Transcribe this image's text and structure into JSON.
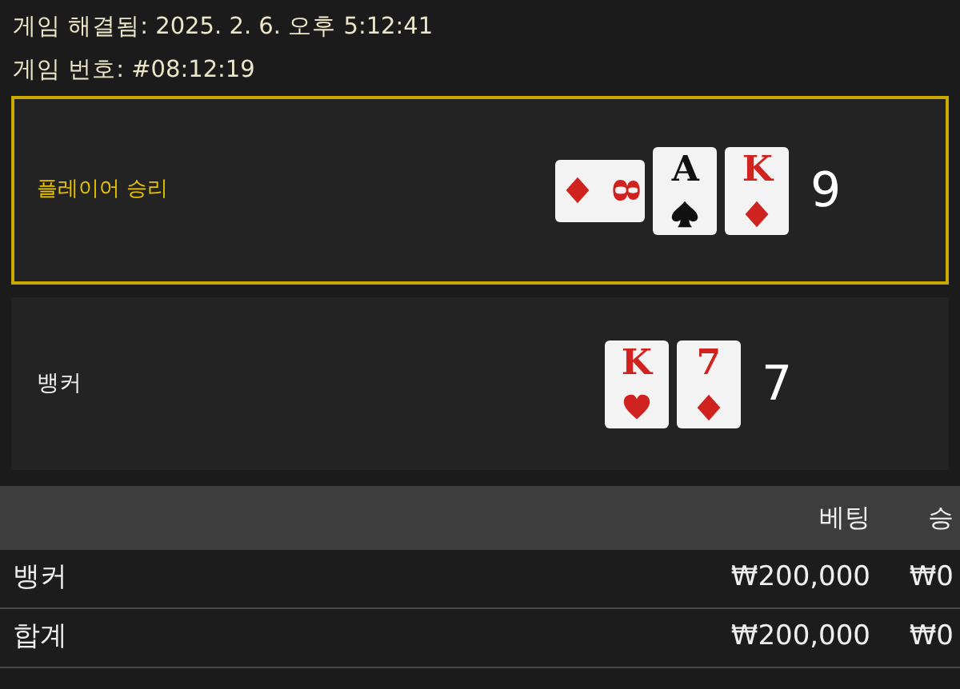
{
  "info": [
    {
      "label": "게임 해결됨:",
      "value": "2025. 2. 6. 오후 5:12:41"
    },
    {
      "label": "게임 번호:",
      "value": "#08:12:19"
    }
  ],
  "hands": [
    {
      "label": "플레이어 승리",
      "winner": true,
      "score": "9",
      "cards": [
        {
          "rank": "8",
          "kind": "diamond",
          "sideways": true
        },
        {
          "rank": "A",
          "kind": "spade",
          "sideways": false
        },
        {
          "rank": "K",
          "kind": "diamond",
          "sideways": false
        }
      ]
    },
    {
      "label": "뱅커",
      "winner": false,
      "score": "7",
      "cards": [
        {
          "rank": "K",
          "kind": "heart",
          "sideways": false
        },
        {
          "rank": "7",
          "kind": "diamond",
          "sideways": false
        }
      ]
    }
  ],
  "bets": {
    "columns": [
      "",
      "베팅",
      "승"
    ],
    "rows": [
      [
        "뱅커",
        "₩200,000",
        "₩0"
      ],
      [
        "합계",
        "₩200,000",
        "₩0"
      ]
    ]
  }
}
